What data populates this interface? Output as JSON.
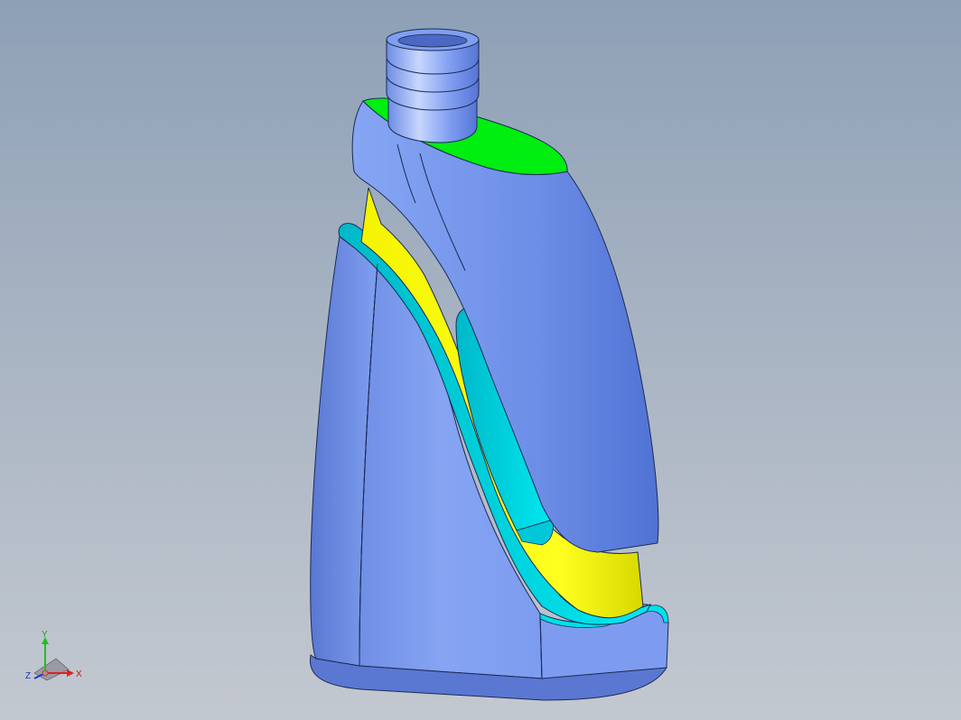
{
  "viewport": {
    "background_top": "#8ea0b6",
    "background_bottom": "#c3c8d0"
  },
  "model": {
    "name": "bottle-section-view",
    "colors": {
      "body": "#7f9ff0",
      "body_dark": "#5f7fd8",
      "cap_face": "#00ee10",
      "section_yellow": "#ffff00",
      "section_cyan": "#00e8f0",
      "edge": "#1a2a55"
    }
  },
  "triad": {
    "x_label": "X",
    "y_label": "Y",
    "z_label": "Z",
    "x_color": "#e02020",
    "y_color": "#20c020",
    "z_color": "#2030e0"
  }
}
